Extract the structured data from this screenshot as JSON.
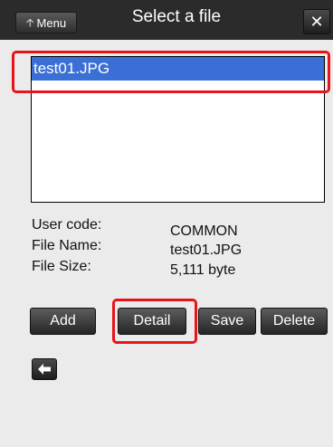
{
  "header": {
    "menu_label": "Menu",
    "menu_icon": "arrow-up-icon",
    "title": "Select a file",
    "close_icon": "close-icon",
    "close_glyph": "✕"
  },
  "file_list": {
    "items": [
      {
        "name": "test01.JPG",
        "selected": true
      }
    ]
  },
  "file_info": {
    "user_code_label": "User code:",
    "user_code_value": "COMMON",
    "file_name_label": "File Name:",
    "file_name_value": "test01.JPG",
    "file_size_label": "File Size:",
    "file_size_value": "5,111 byte"
  },
  "actions": {
    "add_label": "Add",
    "detail_label": "Detail",
    "save_label": "Save",
    "delete_label": "Delete"
  },
  "back_icon": "arrow-left-icon",
  "colors": {
    "header_bg": "#2b2b2b",
    "selection": "#3a6fd6",
    "highlight": "#e8141b",
    "page_bg": "#ebebeb"
  }
}
